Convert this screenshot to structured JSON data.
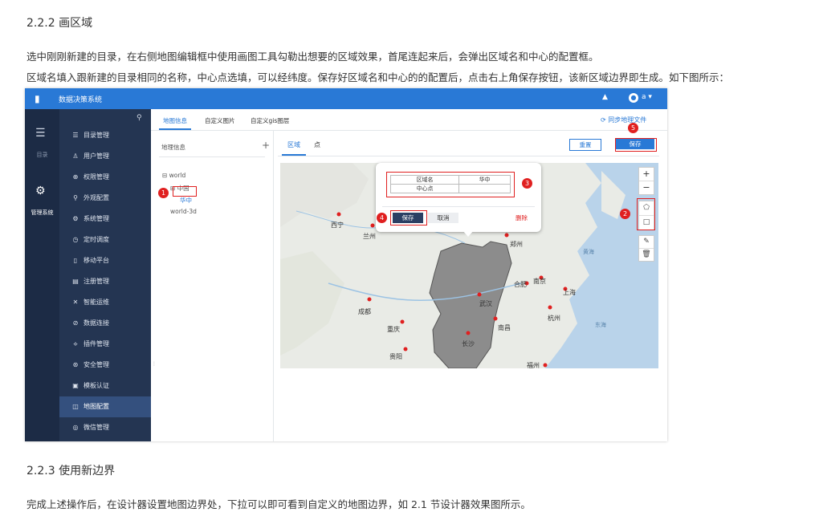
{
  "doc": {
    "heading1": "2.2.2 画区域",
    "para1": "选中刚刚新建的目录，在右侧地图编辑框中使用画图工具勾勒出想要的区域效果，首尾连起来后，会弹出区域名和中心的配置框。",
    "para2": "区域名填入跟新建的目录相同的名称，中心点选填，可以经纬度。保存好区域名和中心的的配置后，点击右上角保存按钮，该新区域边界即生成。如下图所示：",
    "heading2": "2.2.3 使用新边界",
    "para3": "完成上述操作后，在设计器设置地图边界处，下拉可以即可看到自定义的地图边界，如 2.1 节设计器效果图所示。"
  },
  "app": {
    "title": "数据决策系统",
    "user": "a",
    "rail": {
      "catalog": "目录",
      "admin": "管理系统"
    },
    "menu": [
      {
        "icon": "☰",
        "label": "目录管理"
      },
      {
        "icon": "♙",
        "label": "用户管理"
      },
      {
        "icon": "⊕",
        "label": "权限管理"
      },
      {
        "icon": "⚲",
        "label": "外观配置"
      },
      {
        "icon": "⚙",
        "label": "系统管理"
      },
      {
        "icon": "◷",
        "label": "定时调度"
      },
      {
        "icon": "▯",
        "label": "移动平台"
      },
      {
        "icon": "▤",
        "label": "注册管理"
      },
      {
        "icon": "✕",
        "label": "智能运维"
      },
      {
        "icon": "⊘",
        "label": "数据连接"
      },
      {
        "icon": "⟡",
        "label": "插件管理"
      },
      {
        "icon": "⊛",
        "label": "安全管理"
      },
      {
        "icon": "▣",
        "label": "模板认证"
      },
      {
        "icon": "◫",
        "label": "地图配置"
      },
      {
        "icon": "◎",
        "label": "微信管理"
      }
    ],
    "tabs": [
      "地图信息",
      "自定义图片",
      "自定义gis图层"
    ],
    "sync": "同步地理文件",
    "tree": {
      "header": "地理信息",
      "nodes": [
        "world",
        "中国",
        "华中",
        "world-3d"
      ]
    },
    "subtabs": [
      "区域",
      "点"
    ],
    "reset": "重置",
    "save": "保存",
    "popup": {
      "name_label": "区域名",
      "name_value": "华中",
      "center_label": "中心点",
      "center_value": "",
      "ok": "保存",
      "cancel": "取消",
      "delete": "删除"
    },
    "badges": [
      "1",
      "2",
      "3",
      "4",
      "5"
    ],
    "cities": [
      "西宁",
      "兰州",
      "成都",
      "重庆",
      "贵阳",
      "武汉",
      "长沙",
      "合肥",
      "南京",
      "上海",
      "杭州",
      "南昌",
      "福州",
      "郑州",
      "东海",
      "黄海"
    ]
  }
}
